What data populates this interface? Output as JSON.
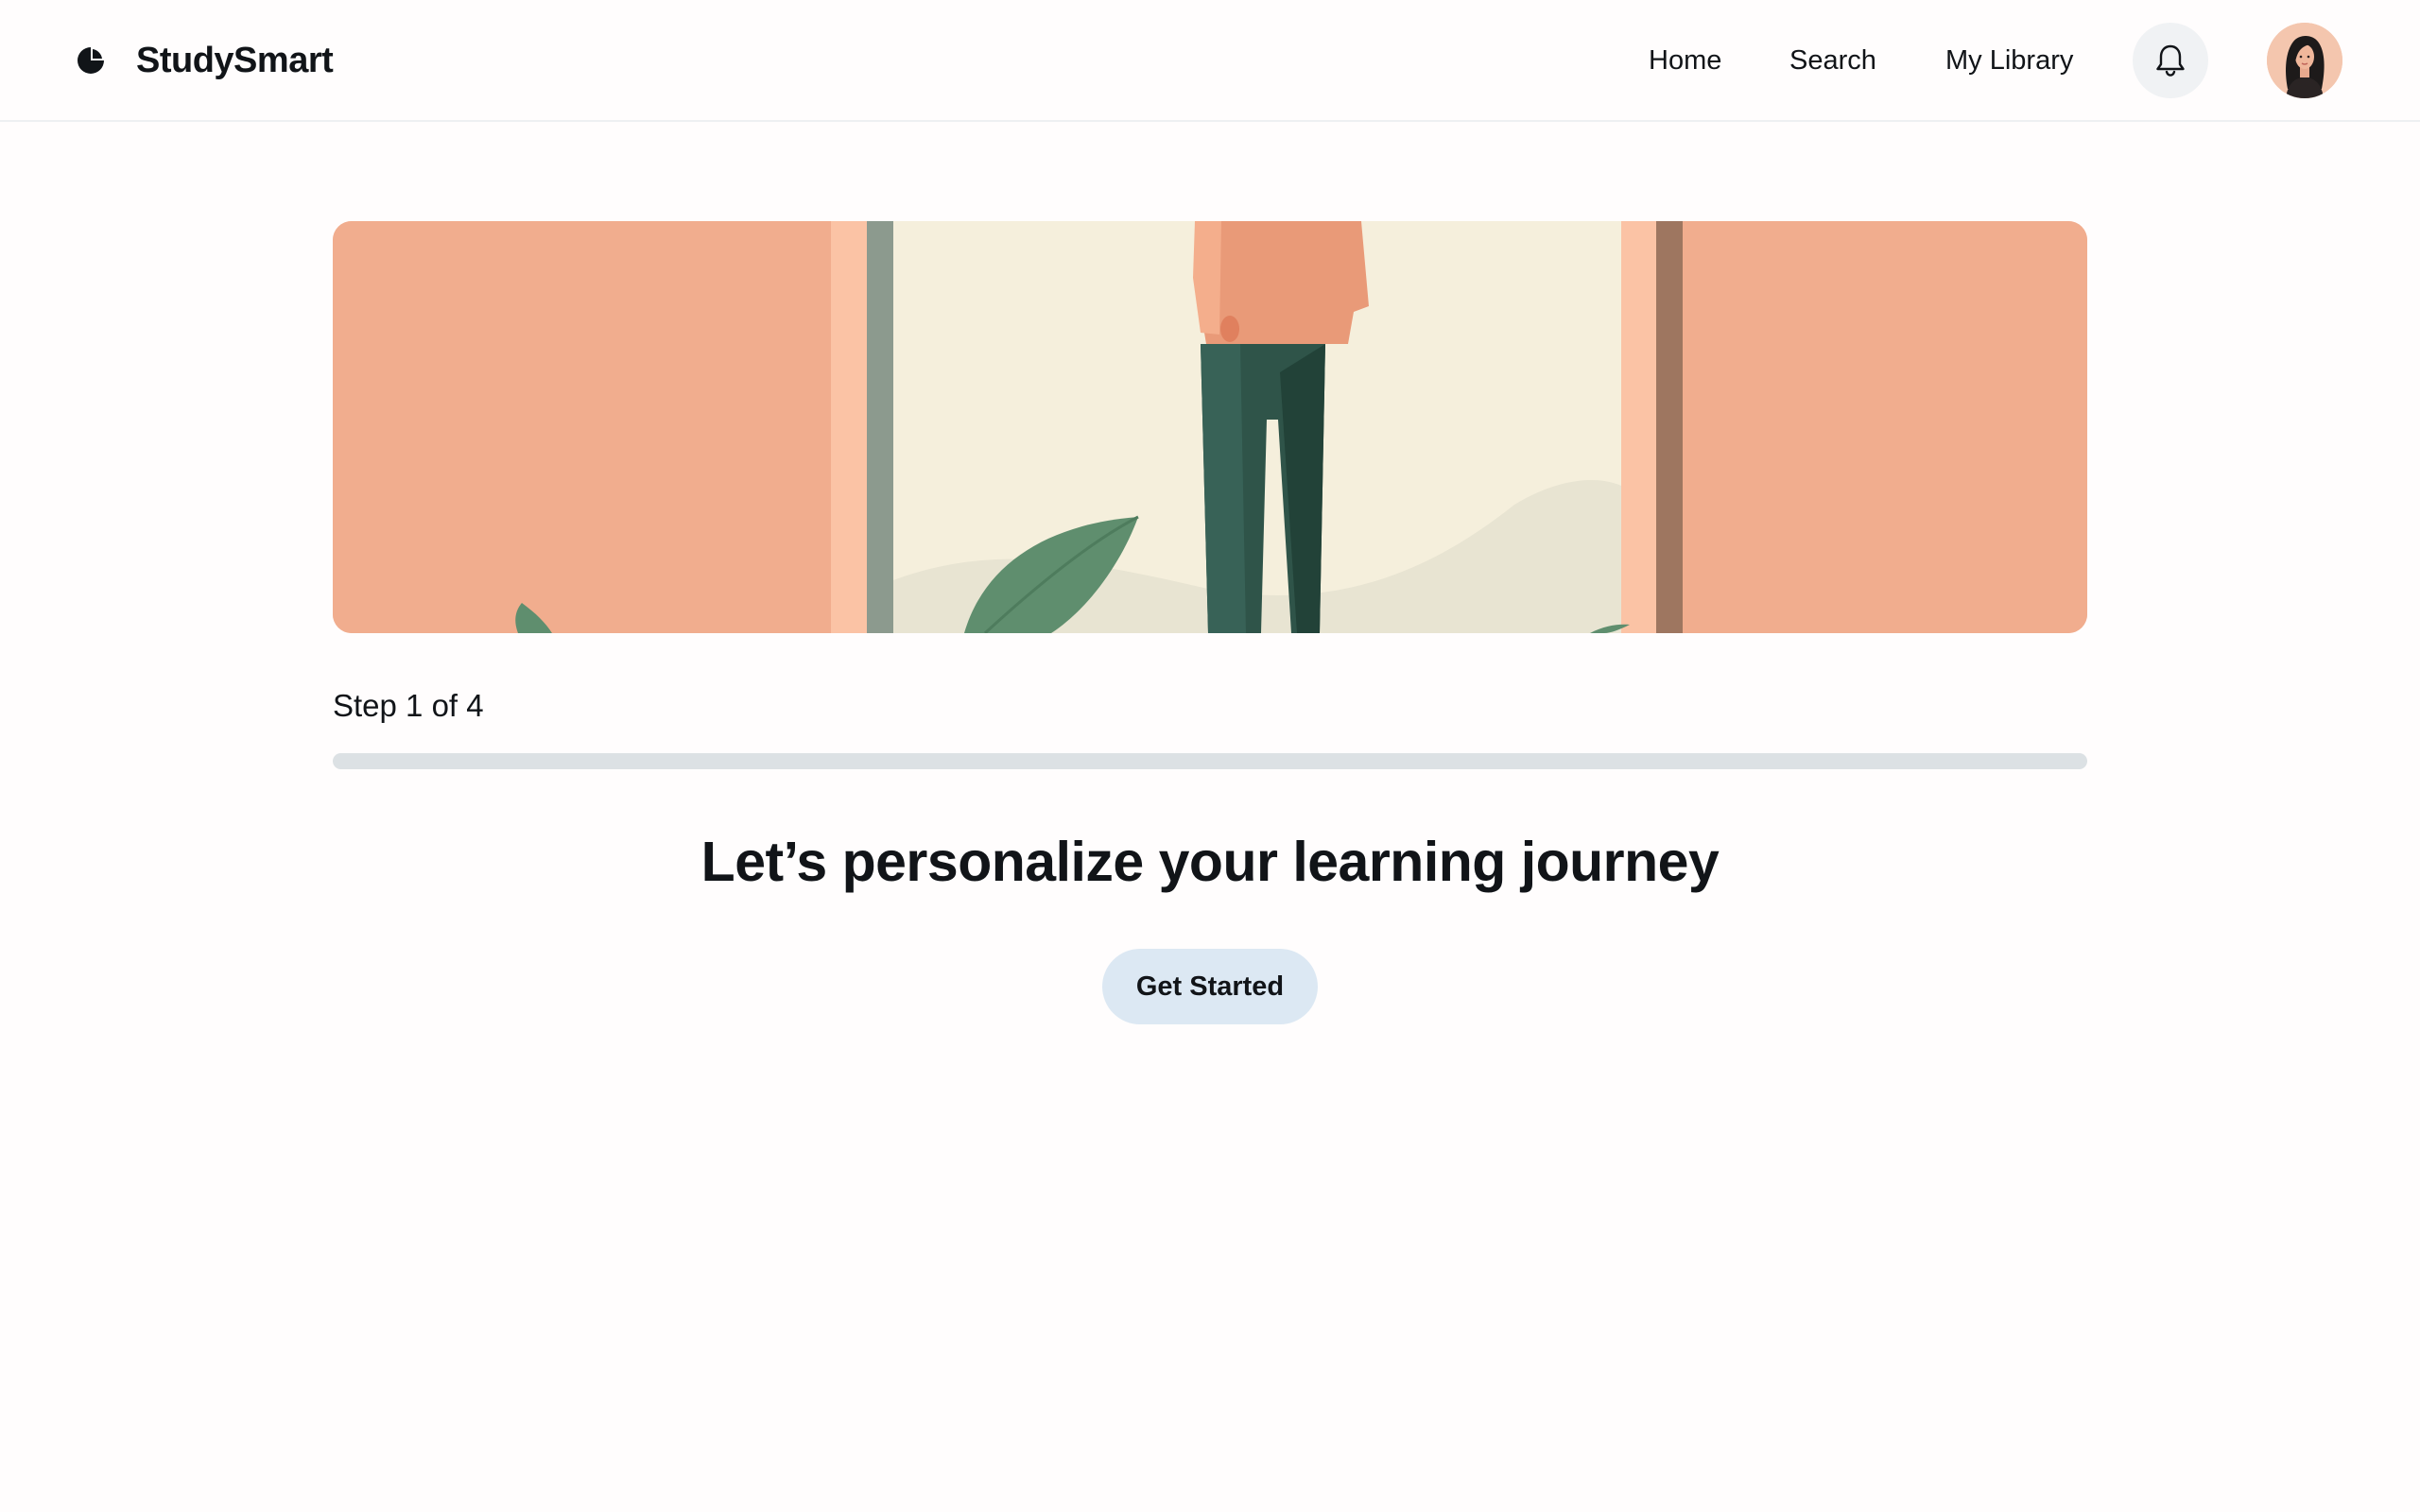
{
  "app": {
    "name": "StudySmart"
  },
  "nav": {
    "items": [
      {
        "label": "Home"
      },
      {
        "label": "Search"
      },
      {
        "label": "My Library"
      }
    ],
    "icons": {
      "logo": "studysmart-logo-icon",
      "notifications": "bell-icon",
      "profile": "user-avatar"
    }
  },
  "onboarding": {
    "step_label": "Step 1 of 4",
    "current_step": 1,
    "total_steps": 4,
    "progress_fraction": 0,
    "title": "Let’s personalize your learning journey",
    "cta_label": "Get Started"
  },
  "colors": {
    "hero_background": "#f1ad8e",
    "progress_track": "#dce1e4",
    "cta_background": "#dce8f3",
    "notification_button": "#f0f2f4"
  }
}
